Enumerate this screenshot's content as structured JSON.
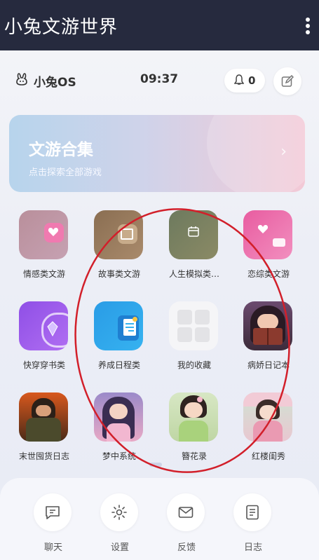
{
  "titlebar": {
    "title": "小兔文游世界"
  },
  "status": {
    "brand": "小兔OS",
    "time": "09:37",
    "notifications": "0"
  },
  "banner": {
    "title": "文游合集",
    "subtitle": "点击探索全部游戏",
    "chevron": "›"
  },
  "apps": [
    {
      "label": "情感类文游",
      "icon": "heart-app-icon"
    },
    {
      "label": "故事类文游",
      "icon": "story-app-icon"
    },
    {
      "label": "人生模拟类…",
      "icon": "calendar-app-icon"
    },
    {
      "label": "恋综类文游",
      "icon": "love-show-app-icon"
    },
    {
      "label": "快穿穿书类",
      "icon": "crystal-app-icon"
    },
    {
      "label": "养成日程类",
      "icon": "schedule-app-icon"
    },
    {
      "label": "我的收藏",
      "icon": "collection-app-icon"
    },
    {
      "label": "病娇日记本",
      "icon": "reading-girl-app-icon"
    },
    {
      "label": "末世囤货日志",
      "icon": "apocalypse-app-icon"
    },
    {
      "label": "梦中系统",
      "icon": "dream-girl-app-icon"
    },
    {
      "label": "簪花录",
      "icon": "hairpin-girl-app-icon"
    },
    {
      "label": "红楼闺秀",
      "icon": "garden-girl-app-icon"
    }
  ],
  "dock": [
    {
      "label": "聊天",
      "icon": "chat-icon"
    },
    {
      "label": "设置",
      "icon": "settings-icon"
    },
    {
      "label": "反馈",
      "icon": "mail-icon"
    },
    {
      "label": "日志",
      "icon": "notebook-icon"
    }
  ],
  "colors": {
    "titlebar": "#262a3e",
    "annotation": "#d21f2a",
    "accent_pink": "#f07ab0"
  }
}
